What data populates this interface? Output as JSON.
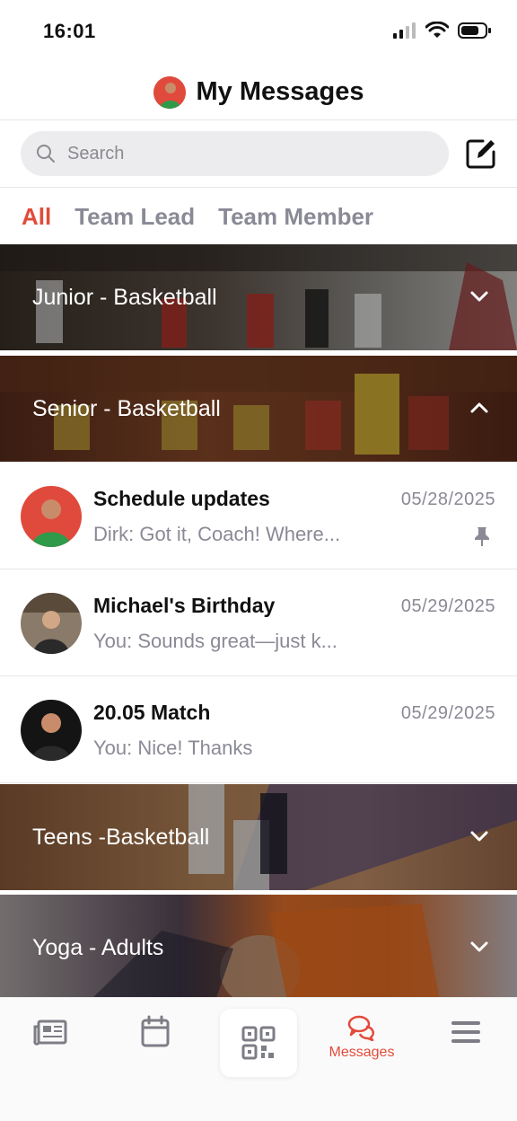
{
  "status_bar": {
    "time": "16:01"
  },
  "header": {
    "title": "My Messages"
  },
  "search": {
    "placeholder": "Search"
  },
  "tabs": [
    {
      "label": "All",
      "active": true
    },
    {
      "label": "Team Lead",
      "active": false
    },
    {
      "label": "Team Member",
      "active": false
    }
  ],
  "groups": [
    {
      "label": "Junior - Basketball",
      "expanded": false
    },
    {
      "label": "Senior - Basketball",
      "expanded": true
    },
    {
      "label": "Teens -Basketball",
      "expanded": false
    },
    {
      "label": "Yoga - Adults",
      "expanded": false
    }
  ],
  "chats": [
    {
      "title": "Schedule updates",
      "date": "05/28/2025",
      "preview": "Dirk: Got it, Coach! Where...",
      "pinned": true
    },
    {
      "title": "Michael's Birthday",
      "date": "05/29/2025",
      "preview": "You: Sounds great—just k...",
      "pinned": false
    },
    {
      "title": "20.05 Match",
      "date": "05/29/2025",
      "preview": "You: Nice! Thanks",
      "pinned": false
    }
  ],
  "tabbar": {
    "messages_label": "Messages"
  },
  "colors": {
    "accent": "#e24b3b",
    "muted": "#8a8a96"
  }
}
